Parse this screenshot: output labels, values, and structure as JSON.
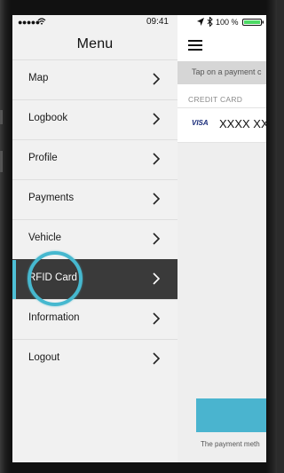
{
  "status_bar": {
    "signal": "●●●●●",
    "time": "09:41",
    "battery_percent": "100 %"
  },
  "menu": {
    "title": "Menu",
    "items": [
      {
        "label": "Map"
      },
      {
        "label": "Logbook"
      },
      {
        "label": "Profile"
      },
      {
        "label": "Payments"
      },
      {
        "label": "Vehicle"
      },
      {
        "label": "RFID Card"
      },
      {
        "label": "Information"
      },
      {
        "label": "Logout"
      }
    ],
    "active_index": 5
  },
  "payments_page": {
    "info_text": "Tap on a payment c",
    "section_label": "CREDIT CARD",
    "card_brand": "VISA",
    "card_number": "XXXX XX",
    "footnote": "The payment meth"
  },
  "colors": {
    "accent": "#4fc0d6",
    "active_row": "#3a3a3a",
    "menu_bg": "#f1f1f1",
    "button": "#4ab4cf"
  },
  "icons": [
    "wifi-icon",
    "location-arrow-icon",
    "bluetooth-icon",
    "battery-icon",
    "hamburger-icon",
    "chevron-right-icon",
    "visa-icon"
  ]
}
